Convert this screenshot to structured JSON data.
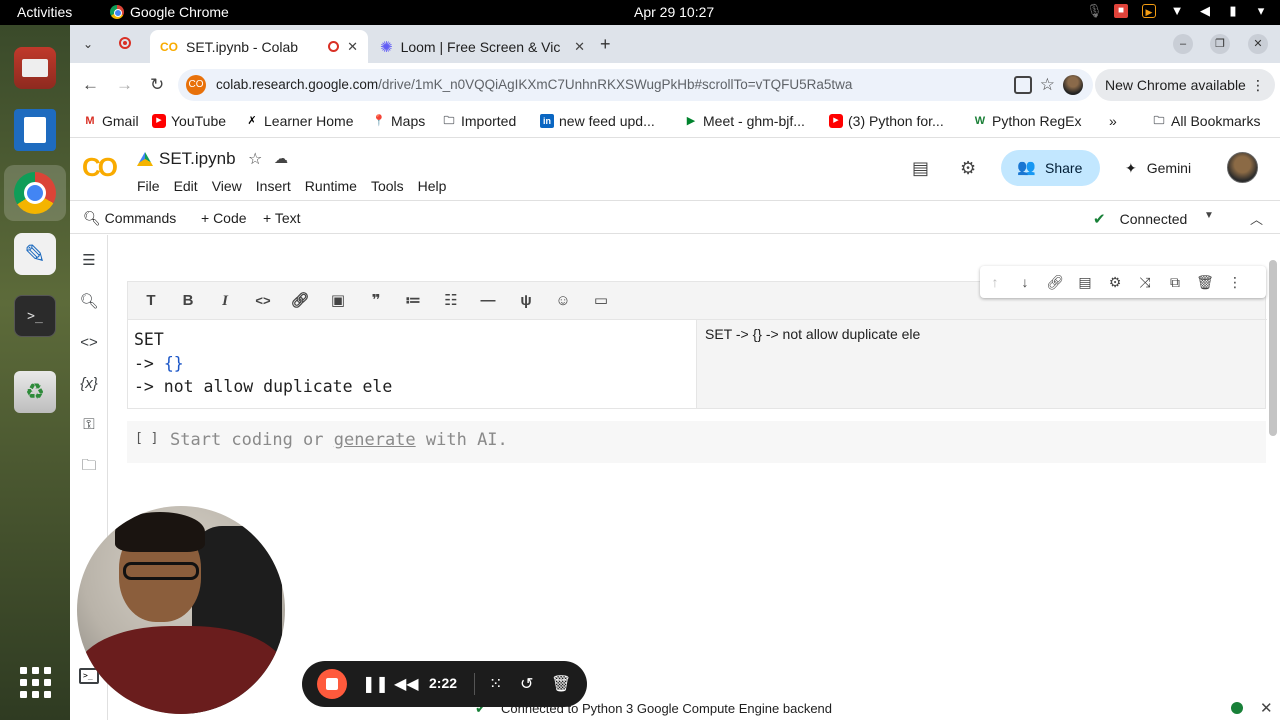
{
  "system": {
    "activities": "Activities",
    "app_name": "Google Chrome",
    "clock": "Apr 29  10:27"
  },
  "browser": {
    "tabs": [
      {
        "title": "SET.ipynb - Colab",
        "active": true
      },
      {
        "title": "Loom | Free Screen & Vic",
        "active": false
      }
    ],
    "new_tab": "+",
    "url_host": "colab.research.google.com",
    "url_path": "/drive/1mK_n0VQQiAgIKXmC7UnhnRKXSWugPkHb#scrollTo=vTQFU5Ra5twa",
    "new_chrome": "New Chrome available",
    "bookmarks": [
      {
        "label": "Gmail",
        "icon": "M"
      },
      {
        "label": "YouTube",
        "icon": "▶"
      },
      {
        "label": "Learner Home",
        "icon": "✗"
      },
      {
        "label": "Maps",
        "icon": "📍"
      },
      {
        "label": "Imported",
        "icon": "🗀"
      },
      {
        "label": "new feed upd...",
        "icon": "in"
      },
      {
        "label": "Meet - ghm-bjf...",
        "icon": "▶"
      },
      {
        "label": "(3) Python for...",
        "icon": "▶"
      },
      {
        "label": "Python RegEx",
        "icon": "W"
      }
    ],
    "bookmarks_more": "»",
    "all_bookmarks": "All Bookmarks"
  },
  "colab": {
    "logo": "CO",
    "notebook_title": "SET.ipynb",
    "menu": [
      "File",
      "Edit",
      "View",
      "Insert",
      "Runtime",
      "Tools",
      "Help"
    ],
    "share": "Share",
    "gemini": "Gemini",
    "actions": {
      "commands": "Commands",
      "code": "+ Code",
      "text": "+ Text",
      "connected": "Connected"
    },
    "text_cell": {
      "line1": "SET",
      "line2_prefix": "-> ",
      "line2_brace": "{}",
      "line3": "-> not allow duplicate ele",
      "preview": "SET -> {} -> not allow duplicate ele"
    },
    "code_cell": {
      "bracket": "[ ]",
      "placeholder_pre": "Start coding or ",
      "placeholder_link": "generate",
      "placeholder_post": " with AI."
    },
    "status": "Connected to Python 3 Google Compute Engine backend"
  },
  "loom": {
    "time": "2:22"
  },
  "colors": {
    "accent": "#f9ab00",
    "share_bg": "#c2e7ff",
    "connected_green": "#188038",
    "loom_stop": "#ff5a3c"
  }
}
